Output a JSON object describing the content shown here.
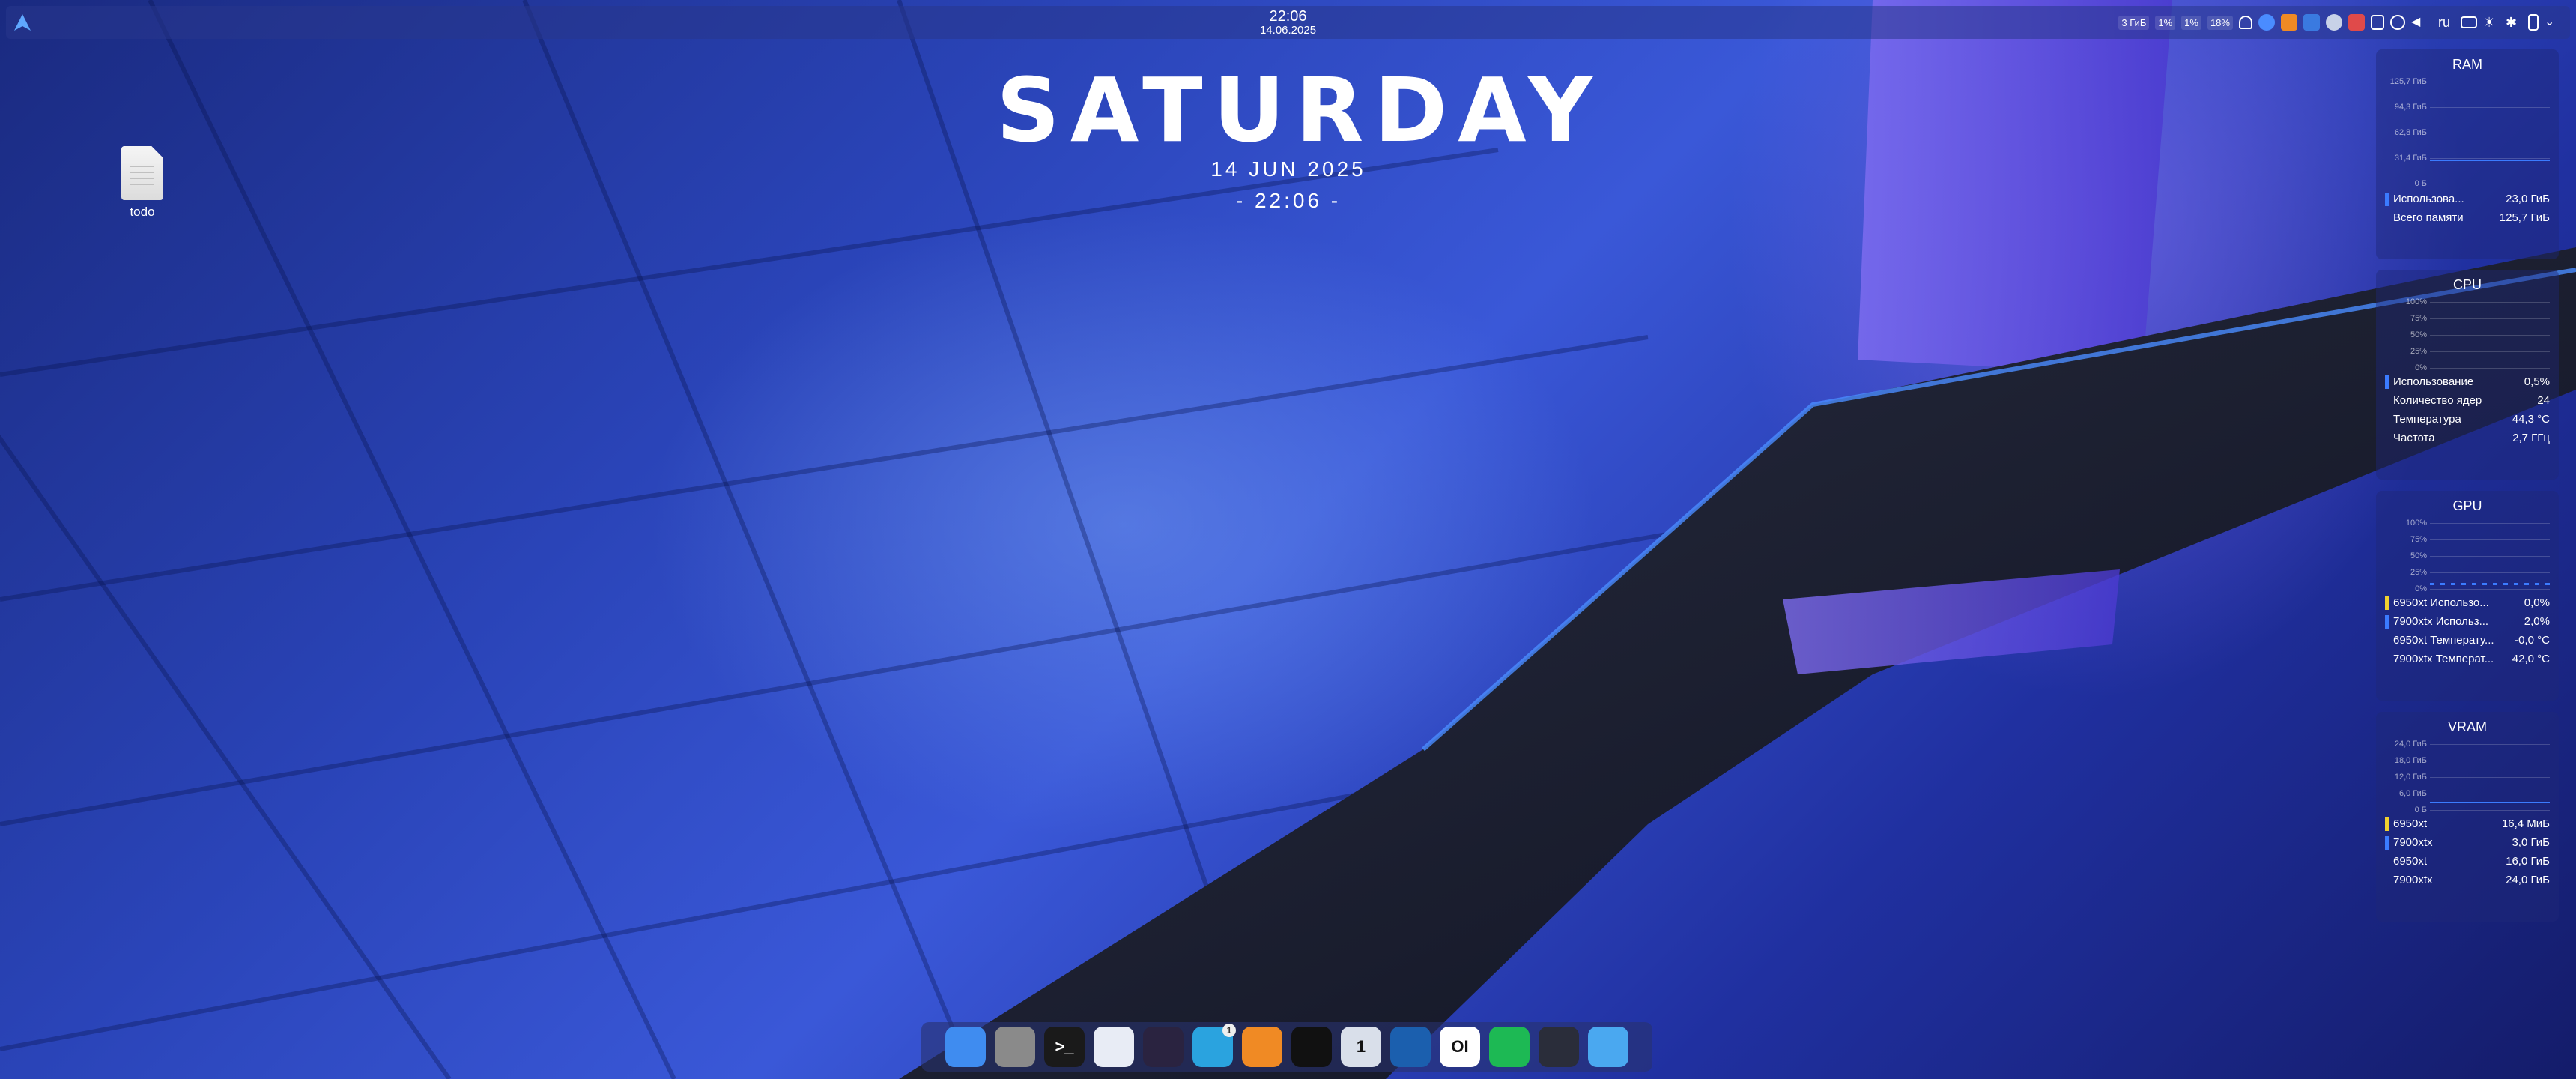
{
  "top_panel": {
    "time": "22:06",
    "date": "14.06.2025",
    "tray": {
      "mem": "3 ГиБ",
      "cpu1": "1%",
      "cpu2": "1%",
      "cpu3": "1%",
      "cpu4": "18%",
      "lang": "ru"
    }
  },
  "desktop": {
    "file_label": "todo"
  },
  "clock_widget": {
    "day": "SATURDAY",
    "date": "14 JUN 2025",
    "time": "- 22:06 -"
  },
  "ram": {
    "title": "RAM",
    "axis": [
      "125,7 ГиБ",
      "94,3 ГиБ",
      "62,8 ГиБ",
      "31,4 ГиБ",
      "0 Б"
    ],
    "rows": [
      {
        "label": "Использова...",
        "value": "23,0 ГиБ",
        "color": "#3b7bff"
      },
      {
        "label": "Всего памяти",
        "value": "125,7 ГиБ"
      }
    ]
  },
  "cpu": {
    "title": "CPU",
    "axis": [
      "100%",
      "75%",
      "50%",
      "25%",
      "0%"
    ],
    "rows": [
      {
        "label": "Использование",
        "value": "0,5%",
        "color": "#3b7bff"
      },
      {
        "label": "Количество ядер",
        "value": "24"
      },
      {
        "label": "Температура",
        "value": "44,3 °C"
      },
      {
        "label": "Частота",
        "value": "2,7 ГГц"
      }
    ]
  },
  "gpu": {
    "title": "GPU",
    "axis": [
      "100%",
      "75%",
      "50%",
      "25%",
      "0%"
    ],
    "rows": [
      {
        "label": "6950xt Использо...",
        "value": "0,0%",
        "color": "#f0d030"
      },
      {
        "label": "7900xtx Использ...",
        "value": "2,0%",
        "color": "#3b7bff"
      },
      {
        "label": "6950xt Температу...",
        "value": "-0,0 °C"
      },
      {
        "label": "7900xtx Температ...",
        "value": "42,0 °C"
      }
    ]
  },
  "vram": {
    "title": "VRAM",
    "axis": [
      "24,0 ГиБ",
      "18,0 ГиБ",
      "12,0 ГиБ",
      "6,0 ГиБ",
      "0 Б"
    ],
    "rows": [
      {
        "label": "6950xt",
        "value": "16,4 МиБ",
        "color": "#f0d030"
      },
      {
        "label": "7900xtx",
        "value": "3,0 ГиБ",
        "color": "#3b7bff"
      },
      {
        "label": "6950xt",
        "value": "16,0 ГиБ"
      },
      {
        "label": "7900xtx",
        "value": "24,0 ГиБ"
      }
    ]
  },
  "dock": {
    "apps": [
      {
        "name": "finder-app-icon",
        "text": "",
        "badge": "",
        "bg": "#3f8cf0"
      },
      {
        "name": "system-settings-app-icon",
        "text": "",
        "badge": "",
        "bg": "#8a8a8a"
      },
      {
        "name": "terminal-app-icon",
        "text": ">_",
        "badge": "",
        "bg": "#1a1a1a"
      },
      {
        "name": "chromium-app-icon",
        "text": "",
        "badge": "",
        "bg": "#e8ecf5"
      },
      {
        "name": "obsidian-app-icon",
        "text": "",
        "badge": "",
        "bg": "#2a2340"
      },
      {
        "name": "telegram-app-icon",
        "text": "",
        "badge": "1",
        "bg": "#2aa3df"
      },
      {
        "name": "orange-app-icon",
        "text": "",
        "badge": "",
        "bg": "#f08a24"
      },
      {
        "name": "box-app-icon",
        "text": "",
        "badge": "",
        "bg": "#111111"
      },
      {
        "name": "1password-app-icon",
        "text": "1",
        "badge": "",
        "bg": "#d9dfea"
      },
      {
        "name": "steam-app-icon",
        "text": "",
        "badge": "",
        "bg": "#1b5fae"
      },
      {
        "name": "ollama-app-icon",
        "text": "OI",
        "badge": "",
        "bg": "#ffffff"
      },
      {
        "name": "spotify-app-icon",
        "text": "",
        "badge": "",
        "bg": "#1db954"
      },
      {
        "name": "game-app-icon",
        "text": "",
        "badge": "",
        "bg": "#2a2d3a"
      },
      {
        "name": "plane-app-icon",
        "text": "",
        "badge": "",
        "bg": "#4aa8f0"
      }
    ]
  }
}
